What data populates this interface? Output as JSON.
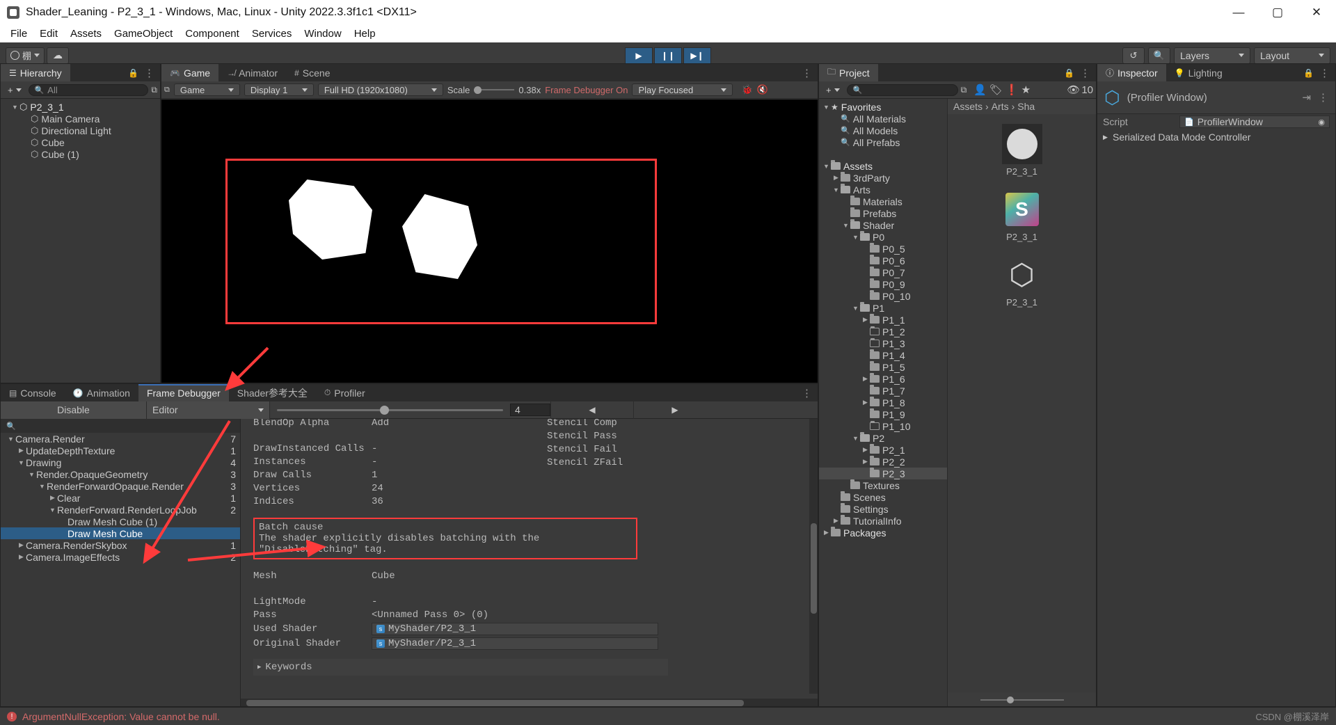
{
  "window": {
    "title": "Shader_Leaning - P2_3_1 - Windows, Mac, Linux - Unity 2022.3.3f1c1 <DX11>",
    "minimize": "—",
    "maximize": "▢",
    "close": "✕"
  },
  "menubar": {
    "items": [
      "File",
      "Edit",
      "Assets",
      "GameObject",
      "Component",
      "Services",
      "Window",
      "Help"
    ]
  },
  "toolbar": {
    "account_icon": "account-icon",
    "account_label": "棚",
    "cloud_icon": "cloud-icon",
    "play": "▶",
    "pause": "❙❙",
    "step": "▶❙",
    "history_icon": "undo-history-icon",
    "search_icon": "search-icon",
    "layers_label": "Layers",
    "layout_label": "Layout"
  },
  "hierarchy": {
    "tab": "Hierarchy",
    "add_label": "+",
    "search_placeholder": "All",
    "items": [
      {
        "label": "P2_3_1",
        "depth": 0,
        "arrow": "▼",
        "icon": "unity-prefab-icon",
        "bold": true
      },
      {
        "label": "Main Camera",
        "depth": 1,
        "arrow": "",
        "icon": "gameobject-icon"
      },
      {
        "label": "Directional Light",
        "depth": 1,
        "arrow": "",
        "icon": "gameobject-icon"
      },
      {
        "label": "Cube",
        "depth": 1,
        "arrow": "",
        "icon": "gameobject-icon"
      },
      {
        "label": "Cube (1)",
        "depth": 1,
        "arrow": "",
        "icon": "gameobject-icon"
      }
    ]
  },
  "sceneview": {
    "tabs": [
      {
        "label": "Scene",
        "icon": "scene-grid-icon",
        "active": false
      },
      {
        "label": "Animator",
        "icon": "animator-icon",
        "active": false
      },
      {
        "label": "Game",
        "icon": "gamepad-icon",
        "active": true
      }
    ],
    "toolbar": {
      "target": "Game",
      "display": "Display 1",
      "resolution": "Full HD (1920x1080)",
      "scale_label": "Scale",
      "scale_value": "0.38x",
      "frame_debugger_status": "Frame Debugger On",
      "play_focus": "Play Focused",
      "stats_icon": "bug-icon",
      "audio_icon": "mute-audio-icon"
    }
  },
  "framedebugger": {
    "tabs": [
      {
        "label": "Console",
        "icon": "console-icon",
        "active": false
      },
      {
        "label": "Animation",
        "icon": "clock-icon",
        "active": false
      },
      {
        "label": "Frame Debugger",
        "icon": "",
        "active": true
      },
      {
        "label": "Shader参考大全",
        "icon": "",
        "active": false
      },
      {
        "label": "Profiler",
        "icon": "stopwatch-icon",
        "active": false
      }
    ],
    "toolbar": {
      "disable_label": "Disable",
      "target_label": "Editor",
      "frame_number": "4",
      "prev_label": "◀",
      "next_label": "▶"
    },
    "search_placeholder": "",
    "tree": [
      {
        "label": "Camera.Render",
        "depth": 0,
        "arrow": "▼",
        "count": "7",
        "selected": false
      },
      {
        "label": "UpdateDepthTexture",
        "depth": 1,
        "arrow": "▶",
        "count": "1",
        "selected": false
      },
      {
        "label": "Drawing",
        "depth": 1,
        "arrow": "▼",
        "count": "4",
        "selected": false
      },
      {
        "label": "Render.OpaqueGeometry",
        "depth": 2,
        "arrow": "▼",
        "count": "3",
        "selected": false
      },
      {
        "label": "RenderForwardOpaque.Render",
        "depth": 3,
        "arrow": "▼",
        "count": "3",
        "selected": false
      },
      {
        "label": "Clear",
        "depth": 4,
        "arrow": "▶",
        "count": "1",
        "selected": false
      },
      {
        "label": "RenderForward.RenderLoopJob",
        "depth": 4,
        "arrow": "▼",
        "count": "2",
        "selected": false
      },
      {
        "label": "Draw Mesh Cube (1)",
        "depth": 5,
        "arrow": "",
        "count": "",
        "selected": false
      },
      {
        "label": "Draw Mesh Cube",
        "depth": 5,
        "arrow": "",
        "count": "",
        "selected": true
      },
      {
        "label": "Camera.RenderSkybox",
        "depth": 1,
        "arrow": "▶",
        "count": "1",
        "selected": false
      },
      {
        "label": "Camera.ImageEffects",
        "depth": 1,
        "arrow": "▶",
        "count": "2",
        "selected": false
      }
    ],
    "detail": {
      "clipped_top": {
        "label": "BlendOp Alpha",
        "value": "Add"
      },
      "rows": [
        {
          "label": "DrawInstanced Calls",
          "value": "-"
        },
        {
          "label": "Instances",
          "value": "-"
        },
        {
          "label": "Draw Calls",
          "value": "1"
        },
        {
          "label": "Vertices",
          "value": "24"
        },
        {
          "label": "Indices",
          "value": "36"
        }
      ],
      "batch_cause_title": "Batch cause",
      "batch_cause_text": "The shader explicitly disables batching with the \"DisableBatching\" tag.",
      "mesh_label": "Mesh",
      "mesh_value": "Cube",
      "lightmode_label": "LightMode",
      "lightmode_value": "-",
      "pass_label": "Pass",
      "pass_value": "<Unnamed Pass 0> (0)",
      "used_shader_label": "Used Shader",
      "used_shader_value": "MyShader/P2_3_1",
      "original_shader_label": "Original Shader",
      "original_shader_value": "MyShader/P2_3_1",
      "keywords_label": "Keywords",
      "stencil": [
        "Stencil Comp",
        "Stencil Pass",
        "Stencil Fail",
        "Stencil ZFail"
      ]
    }
  },
  "project": {
    "tab": "Project",
    "add_label": "+",
    "search_placeholder": "",
    "badge_count": "10",
    "breadcrumb": [
      "Assets",
      "Arts",
      "Sha"
    ],
    "tree": [
      {
        "label": "Favorites",
        "depth": 0,
        "arrow": "▼",
        "icon": "star-icon",
        "bold": true
      },
      {
        "label": "All Materials",
        "depth": 1,
        "arrow": "",
        "icon": "search-icon"
      },
      {
        "label": "All Models",
        "depth": 1,
        "arrow": "",
        "icon": "search-icon"
      },
      {
        "label": "All Prefabs",
        "depth": 1,
        "arrow": "",
        "icon": "search-icon"
      },
      {
        "label": "",
        "depth": 0,
        "arrow": "",
        "icon": "spacer"
      },
      {
        "label": "Assets",
        "depth": 0,
        "arrow": "▼",
        "icon": "folder-open-icon",
        "bold": true
      },
      {
        "label": "3rdParty",
        "depth": 1,
        "arrow": "▶",
        "icon": "folder-icon"
      },
      {
        "label": "Arts",
        "depth": 1,
        "arrow": "▼",
        "icon": "folder-open-icon"
      },
      {
        "label": "Materials",
        "depth": 2,
        "arrow": "",
        "icon": "folder-icon"
      },
      {
        "label": "Prefabs",
        "depth": 2,
        "arrow": "",
        "icon": "folder-icon"
      },
      {
        "label": "Shader",
        "depth": 2,
        "arrow": "▼",
        "icon": "folder-open-icon"
      },
      {
        "label": "P0",
        "depth": 3,
        "arrow": "▼",
        "icon": "folder-open-icon"
      },
      {
        "label": "P0_5",
        "depth": 4,
        "arrow": "",
        "icon": "folder-icon"
      },
      {
        "label": "P0_6",
        "depth": 4,
        "arrow": "",
        "icon": "folder-icon"
      },
      {
        "label": "P0_7",
        "depth": 4,
        "arrow": "",
        "icon": "folder-icon"
      },
      {
        "label": "P0_9",
        "depth": 4,
        "arrow": "",
        "icon": "folder-icon"
      },
      {
        "label": "P0_10",
        "depth": 4,
        "arrow": "",
        "icon": "folder-icon"
      },
      {
        "label": "P1",
        "depth": 3,
        "arrow": "▼",
        "icon": "folder-open-icon"
      },
      {
        "label": "P1_1",
        "depth": 4,
        "arrow": "▶",
        "icon": "folder-icon"
      },
      {
        "label": "P1_2",
        "depth": 4,
        "arrow": "",
        "icon": "folder-hollow-icon"
      },
      {
        "label": "P1_3",
        "depth": 4,
        "arrow": "",
        "icon": "folder-hollow-icon"
      },
      {
        "label": "P1_4",
        "depth": 4,
        "arrow": "",
        "icon": "folder-icon"
      },
      {
        "label": "P1_5",
        "depth": 4,
        "arrow": "",
        "icon": "folder-icon"
      },
      {
        "label": "P1_6",
        "depth": 4,
        "arrow": "▶",
        "icon": "folder-icon"
      },
      {
        "label": "P1_7",
        "depth": 4,
        "arrow": "",
        "icon": "folder-icon"
      },
      {
        "label": "P1_8",
        "depth": 4,
        "arrow": "▶",
        "icon": "folder-icon"
      },
      {
        "label": "P1_9",
        "depth": 4,
        "arrow": "",
        "icon": "folder-icon"
      },
      {
        "label": "P1_10",
        "depth": 4,
        "arrow": "",
        "icon": "folder-hollow-icon"
      },
      {
        "label": "P2",
        "depth": 3,
        "arrow": "▼",
        "icon": "folder-open-icon"
      },
      {
        "label": "P2_1",
        "depth": 4,
        "arrow": "▶",
        "icon": "folder-icon"
      },
      {
        "label": "P2_2",
        "depth": 4,
        "arrow": "▶",
        "icon": "folder-icon"
      },
      {
        "label": "P2_3",
        "depth": 4,
        "arrow": "",
        "icon": "folder-icon",
        "selected": true
      },
      {
        "label": "Textures",
        "depth": 2,
        "arrow": "",
        "icon": "folder-icon"
      },
      {
        "label": "Scenes",
        "depth": 1,
        "arrow": "",
        "icon": "folder-icon"
      },
      {
        "label": "Settings",
        "depth": 1,
        "arrow": "",
        "icon": "folder-icon"
      },
      {
        "label": "TutorialInfo",
        "depth": 1,
        "arrow": "▶",
        "icon": "folder-icon"
      },
      {
        "label": "Packages",
        "depth": 0,
        "arrow": "▶",
        "icon": "folder-icon",
        "bold": true
      }
    ],
    "assets": [
      {
        "label": "P2_3_1",
        "icon": "material-sphere-icon"
      },
      {
        "label": "P2_3_1",
        "icon": "shader-icon"
      },
      {
        "label": "P2_3_1",
        "icon": "unity-prefab-icon"
      }
    ]
  },
  "inspector": {
    "tabs": [
      {
        "label": "Inspector",
        "icon": "info-icon",
        "active": true
      },
      {
        "label": "Lighting",
        "icon": "light-bulb-icon",
        "active": false
      }
    ],
    "object_title": "(Profiler Window)",
    "object_icon": "script-object-icon",
    "script_label": "Script",
    "script_value": "ProfilerWindow",
    "serialized_row": "Serialized Data Mode Controller"
  },
  "statusbar": {
    "message": "ArgumentNullException: Value cannot be null.",
    "watermark": "CSDN @棚溪泽岸"
  },
  "colors": {
    "accent_blue": "#2c5d87",
    "annotation_red": "#ff3b3b",
    "warning_red": "#d46a6a"
  }
}
